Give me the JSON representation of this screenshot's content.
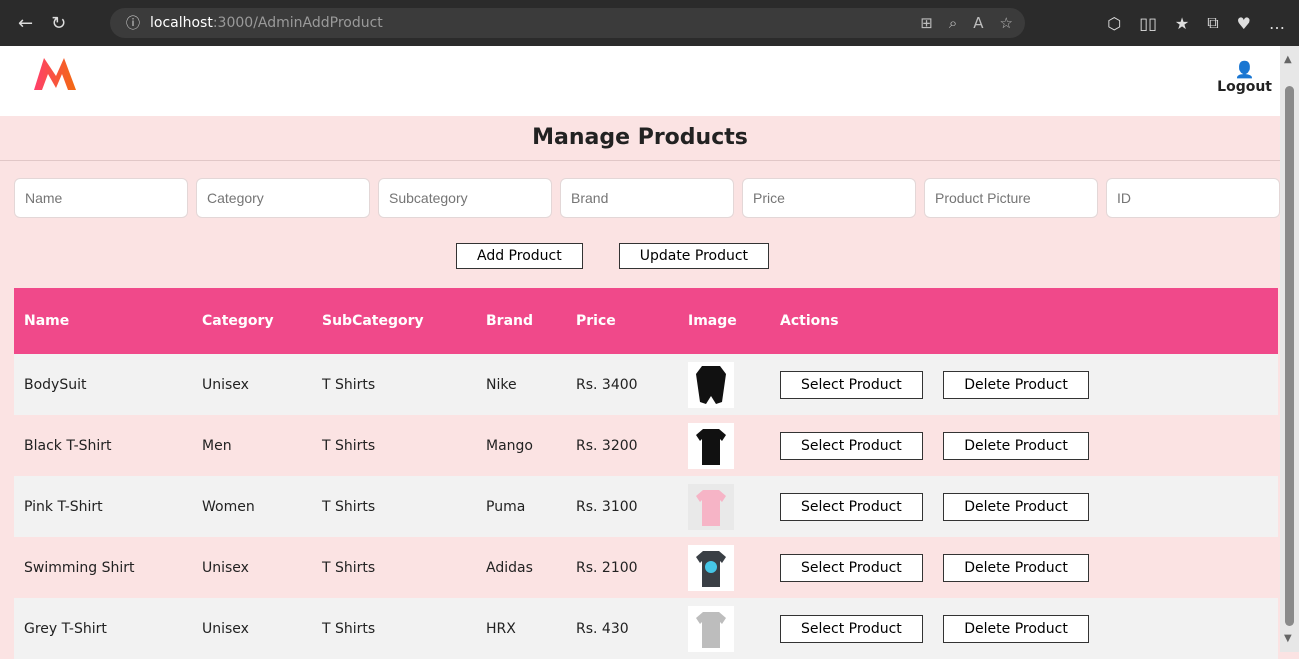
{
  "browser": {
    "address_info_icon": "info-icon",
    "url_host": "localhost",
    "url_path": ":3000/AdminAddProduct"
  },
  "header": {
    "logout_label": "Logout"
  },
  "page": {
    "title": "Manage Products"
  },
  "form": {
    "placeholders": {
      "name": "Name",
      "category": "Category",
      "subcategory": "Subcategory",
      "brand": "Brand",
      "price": "Price",
      "product_picture": "Product Picture",
      "id": "ID"
    },
    "buttons": {
      "add": "Add Product",
      "update": "Update Product"
    }
  },
  "table": {
    "headers": [
      "Name",
      "Category",
      "SubCategory",
      "Brand",
      "Price",
      "Image",
      "Actions"
    ],
    "rows": [
      {
        "name": "BodySuit",
        "category": "Unisex",
        "subcategory": "T Shirts",
        "brand": "Nike",
        "price": "Rs. 3400",
        "image": "bodysuit"
      },
      {
        "name": "Black T-Shirt",
        "category": "Men",
        "subcategory": "T Shirts",
        "brand": "Mango",
        "price": "Rs. 3200",
        "image": "black-tshirt"
      },
      {
        "name": "Pink T-Shirt",
        "category": "Women",
        "subcategory": "T Shirts",
        "brand": "Puma",
        "price": "Rs. 3100",
        "image": "pink-tshirt"
      },
      {
        "name": "Swimming Shirt",
        "category": "Unisex",
        "subcategory": "T Shirts",
        "brand": "Adidas",
        "price": "Rs. 2100",
        "image": "swim-shirt"
      },
      {
        "name": "Grey T-Shirt",
        "category": "Unisex",
        "subcategory": "T Shirts",
        "brand": "HRX",
        "price": "Rs. 430",
        "image": "grey-tshirt"
      }
    ],
    "row_actions": {
      "select": "Select Product",
      "delete": "Delete Product"
    }
  },
  "colors": {
    "accent": "#f0498a",
    "row_odd": "#f2f2f2",
    "row_even": "#fbe3e3"
  }
}
